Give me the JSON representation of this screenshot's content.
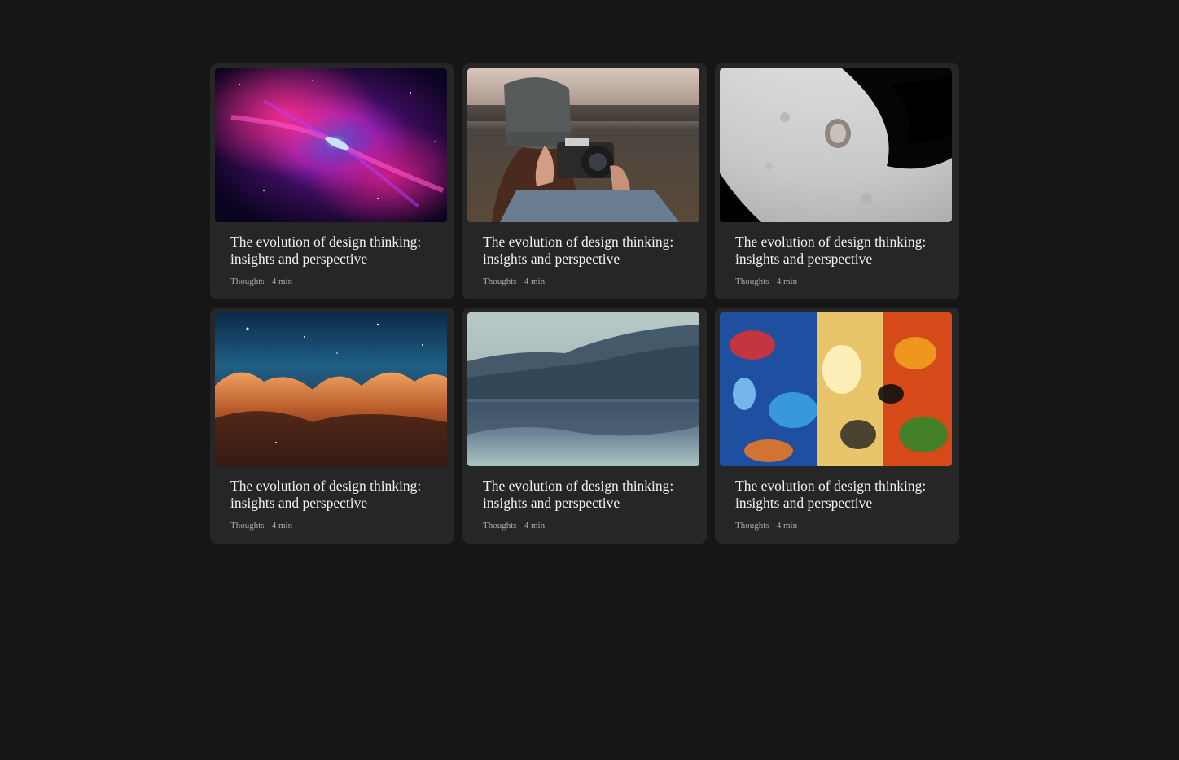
{
  "cards": [
    {
      "image_name": "nebula-image",
      "title": "The evolution of design thinking: insights and perspective",
      "meta": "Thoughts - 4 min"
    },
    {
      "image_name": "photographer-image",
      "title": "The evolution of design thinking: insights and perspective",
      "meta": "Thoughts - 4 min"
    },
    {
      "image_name": "moon-image",
      "title": "The evolution of design thinking: insights and perspective",
      "meta": "Thoughts - 4 min"
    },
    {
      "image_name": "cosmic-cliffs-image",
      "title": "The evolution of design thinking: insights and perspective",
      "meta": "Thoughts - 4 min"
    },
    {
      "image_name": "lake-forest-image",
      "title": "The evolution of design thinking: insights and perspective",
      "meta": "Thoughts - 4 min"
    },
    {
      "image_name": "abstract-paint-image",
      "title": "The evolution of design thinking: insights and perspective",
      "meta": "Thoughts - 4 min"
    }
  ],
  "colors": {
    "page_background": "#161616",
    "card_background": "#262626",
    "title_text": "#f2f2f2",
    "meta_text": "#a9a9a9"
  }
}
